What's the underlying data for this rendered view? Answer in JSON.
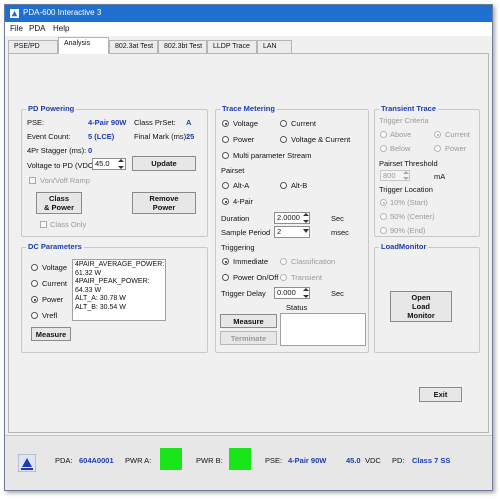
{
  "window": {
    "title": "PDA-600 Interactive 3"
  },
  "menu": [
    "File",
    "PDA",
    "Help"
  ],
  "tabs": [
    "PSE/PD",
    "Analysis",
    "802.3at Test",
    "802.3bt Test",
    "LLDP Trace",
    "LAN"
  ],
  "active_tab": "Analysis",
  "pd_powering": {
    "title": "PD Powering",
    "pse_label": "PSE:",
    "pse_value": "4-Pair 90W",
    "class_preset_label": "Class PrSet:",
    "class_preset_value": "A",
    "event_count_label": "Event Count:",
    "event_count_value": "5 (LCE)",
    "final_mark_label": "Final Mark (ms):",
    "final_mark_value": "25",
    "stagger_label": "4Pr Stagger (ms):",
    "stagger_value": "0",
    "voltage_label": "Voltage to PD (VDC)",
    "voltage_value": "45.0",
    "update_label": "Update",
    "ramp_label": "Von/Voff Ramp",
    "class_power_label": "Class\n& Power",
    "remove_power_label": "Remove\nPower",
    "class_only_label": "Class Only"
  },
  "dc_parameters": {
    "title": "DC Parameters",
    "options": [
      "Voltage",
      "Current",
      "Power",
      "Vrefl"
    ],
    "selected": "Power",
    "readout": [
      "4PAIR_AVERAGE_POWER: 61.32 W",
      "4PAIR_PEAK_POWER: 64.33 W",
      "ALT_A: 30.78 W",
      "ALT_B: 30.54 W"
    ],
    "measure_label": "Measure"
  },
  "trace_metering": {
    "title": "Trace Metering",
    "mode_options": [
      "Voltage",
      "Current",
      "Power",
      "Voltage & Current",
      "Multi parameter Stream"
    ],
    "mode_selected": "Voltage",
    "pairset_label": "Pairset",
    "pairset_options": [
      "Alt-A",
      "Alt-B",
      "4-Pair"
    ],
    "pairset_selected": "4-Pair",
    "duration_label": "Duration",
    "duration_value": "2.0000",
    "duration_unit": "Sec",
    "sample_period_label": "Sample Period",
    "sample_period_value": "2",
    "sample_period_unit": "msec",
    "triggering_label": "Triggering",
    "trigger_options": [
      "Immediate",
      "Classification",
      "Power On/Off",
      "Transient"
    ],
    "trigger_selected": "Immediate",
    "trigger_delay_label": "Trigger Delay",
    "trigger_delay_value": "0.000",
    "trigger_delay_unit": "Sec",
    "status_label": "Status",
    "measure_label": "Measure",
    "terminate_label": "Terminate"
  },
  "transient_trace": {
    "title": "Transient Trace",
    "criteria_label": "Trigger Criteria",
    "criteria_options": [
      "Above",
      "Current",
      "Below",
      "Power"
    ],
    "threshold_label": "Pairset Threshold",
    "threshold_value": "800",
    "threshold_unit": "mA",
    "location_label": "Trigger Location",
    "location_options": [
      "10% (Start)",
      "50% (Center)",
      "90% (End)"
    ]
  },
  "load_monitor": {
    "title": "LoadMonitor",
    "open_label": "Open\nLoad\nMonitor"
  },
  "exit_label": "Exit",
  "statusbar": {
    "pda_label": "PDA:",
    "pda_value": "604A0001",
    "pwr_a_label": "PWR A:",
    "pwr_b_label": "PWR B:",
    "pse_label": "PSE:",
    "pse_value": "4-Pair 90W",
    "voltage_value": "45.0",
    "voltage_unit": "VDC",
    "pd_label": "PD:",
    "pd_value": "Class 7 SS",
    "indicator_color": "#19e619"
  },
  "colors": {
    "titlebar": "#1d6fd0",
    "accent_blue": "#1d3bb0"
  }
}
